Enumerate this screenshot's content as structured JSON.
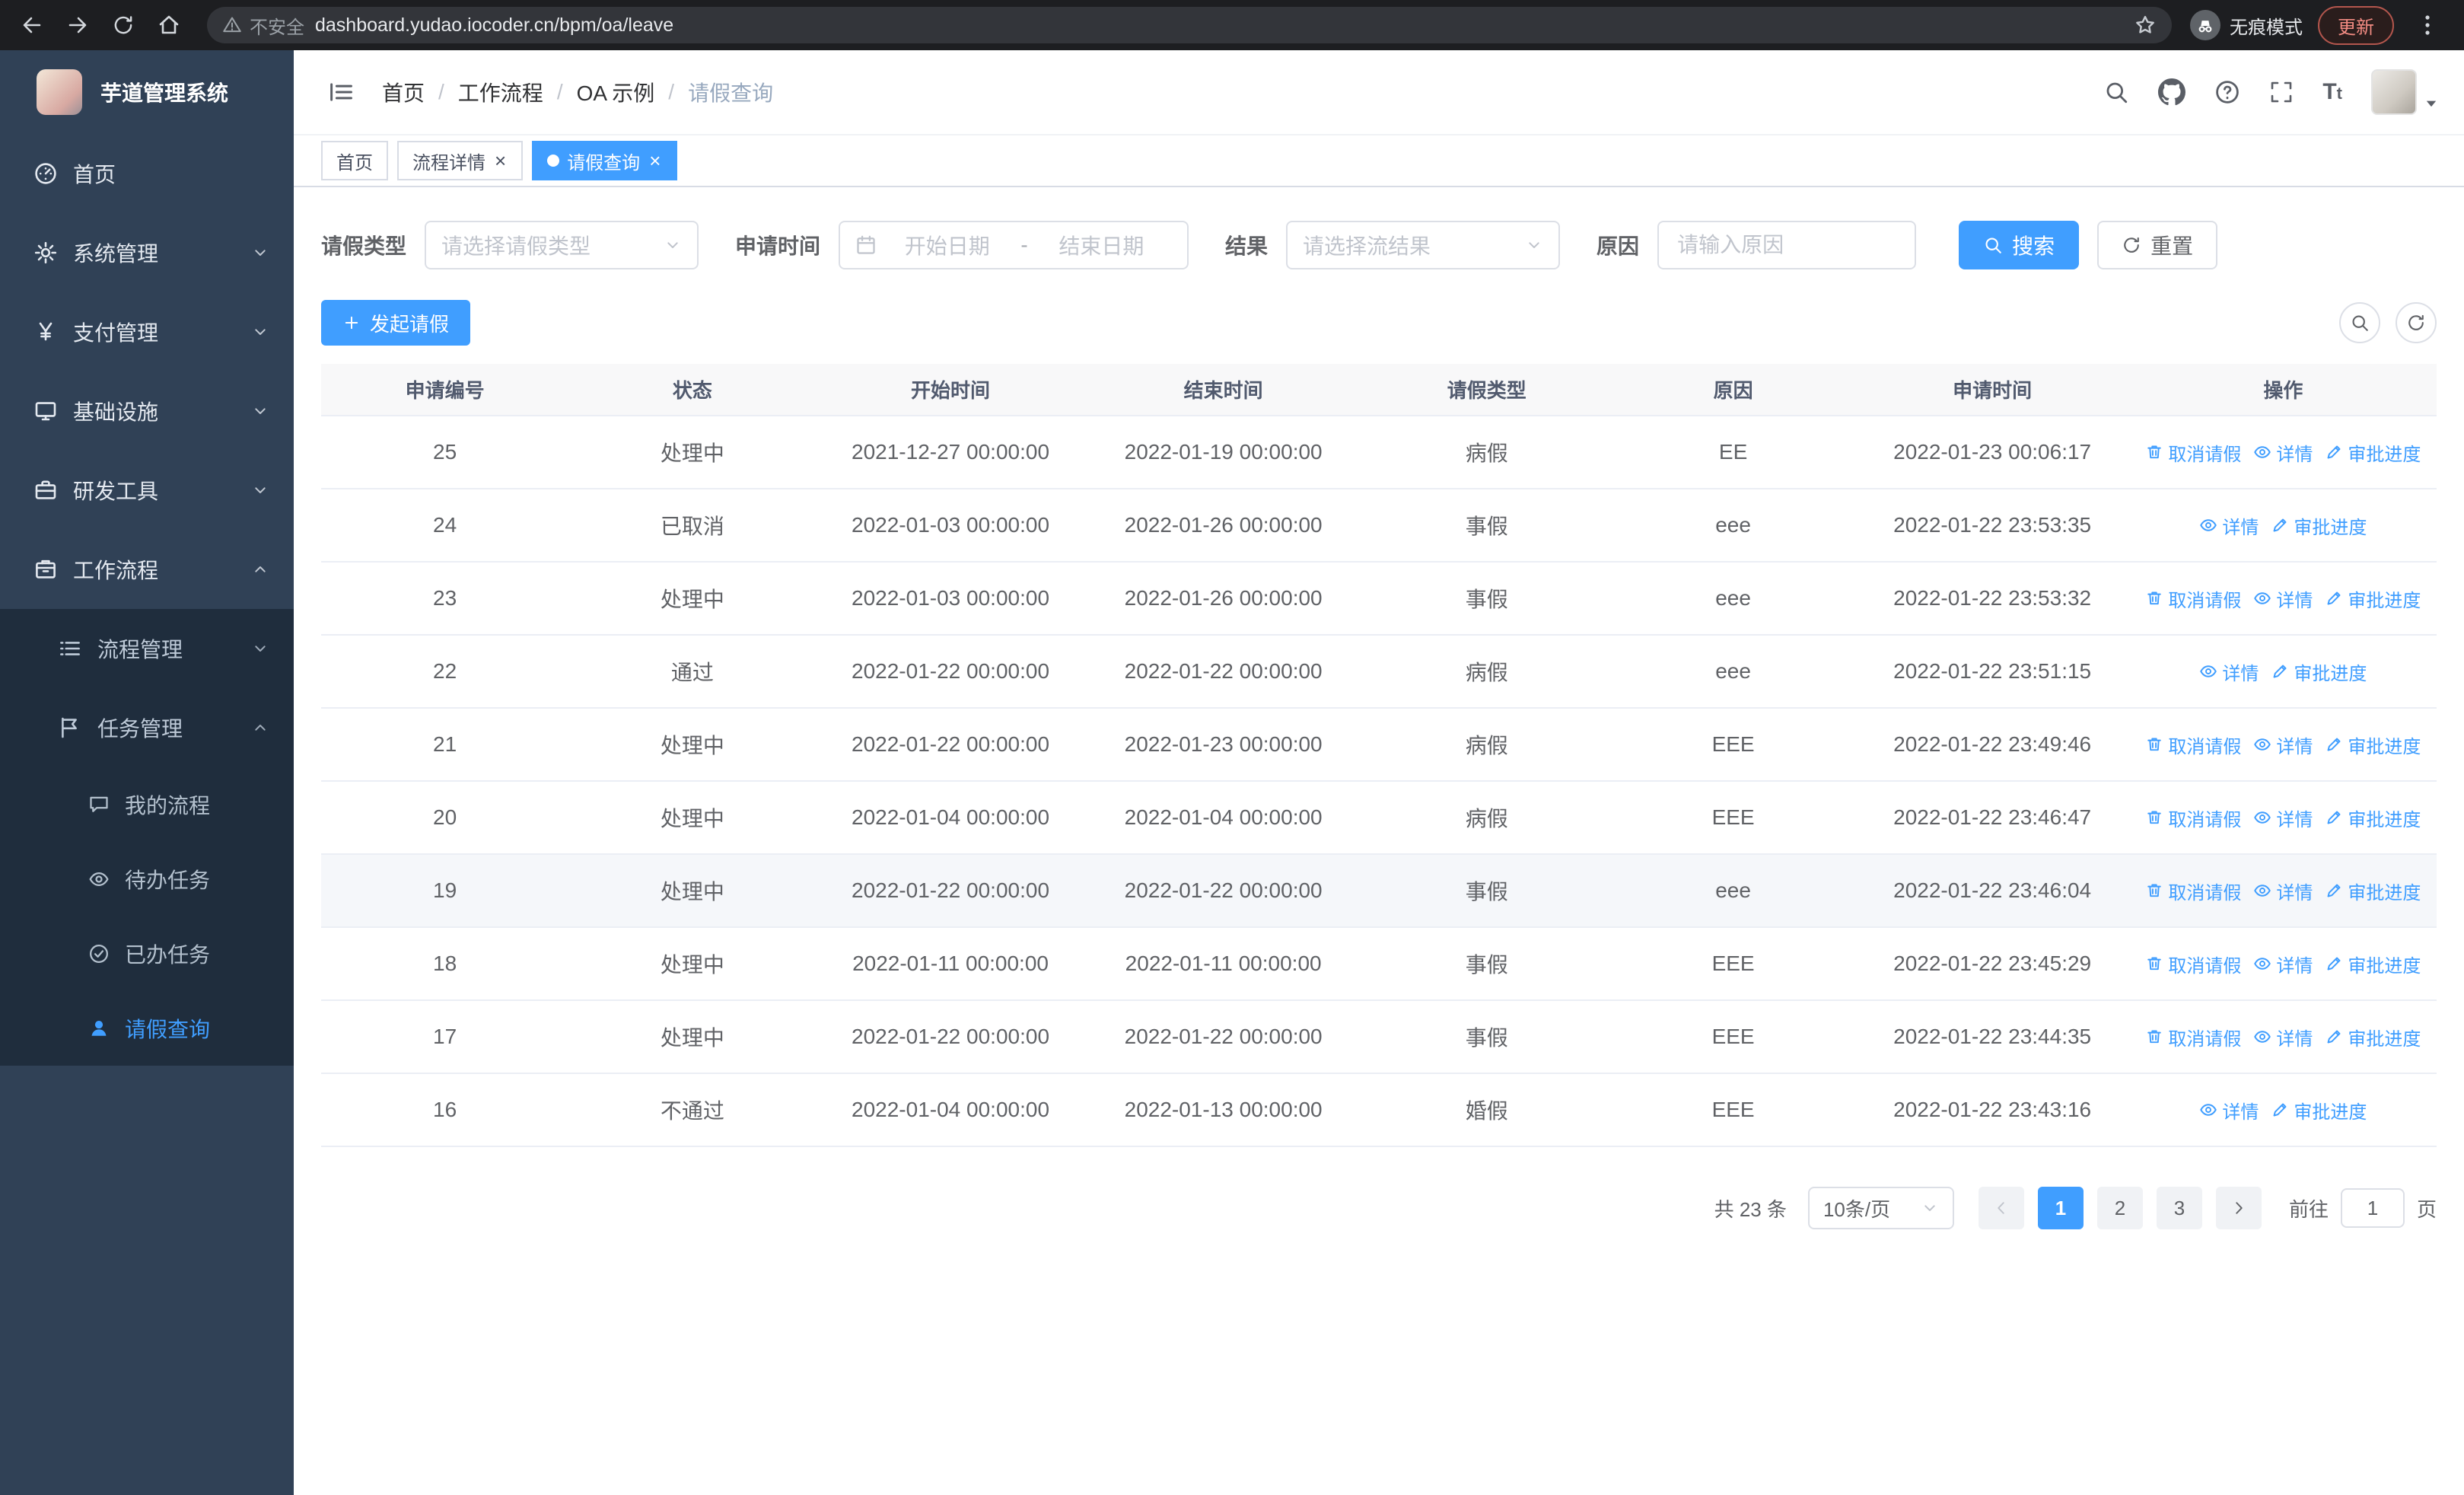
{
  "colors": {
    "accent": "#409eff",
    "sidebar_bg": "#304156",
    "submenu_bg": "#1f2d3d",
    "update_badge": "#f28b82"
  },
  "browser": {
    "security_label": "不安全",
    "url": "dashboard.yudao.iocoder.cn/bpm/oa/leave",
    "incognito_label": "无痕模式",
    "update_label": "更新"
  },
  "sidebar": {
    "app_title": "芋道管理系统",
    "menu": [
      {
        "id": "home",
        "label": "首页",
        "icon": "home",
        "level": 1
      },
      {
        "id": "system",
        "label": "系统管理",
        "icon": "gear",
        "level": 1,
        "arrow": "down"
      },
      {
        "id": "payment",
        "label": "支付管理",
        "icon": "yen",
        "level": 1,
        "arrow": "down"
      },
      {
        "id": "infra",
        "label": "基础设施",
        "icon": "infra",
        "level": 1,
        "arrow": "down"
      },
      {
        "id": "devtools",
        "label": "研发工具",
        "icon": "tools",
        "level": 1,
        "arrow": "down"
      },
      {
        "id": "workflow",
        "label": "工作流程",
        "icon": "workflow",
        "level": 1,
        "arrow": "up"
      },
      {
        "id": "process-mgmt",
        "label": "流程管理",
        "icon": "list-menu",
        "level": 2,
        "arrow": "down"
      },
      {
        "id": "task-mgmt",
        "label": "任务管理",
        "icon": "tasks",
        "level": 2,
        "arrow": "up"
      },
      {
        "id": "my-process",
        "label": "我的流程",
        "icon": "chat",
        "level": 3
      },
      {
        "id": "todo-task",
        "label": "待办任务",
        "icon": "eye",
        "level": 3
      },
      {
        "id": "done-task",
        "label": "已办任务",
        "icon": "done",
        "level": 3
      },
      {
        "id": "leave-query",
        "label": "请假查询",
        "icon": "user",
        "level": 3,
        "active": true
      }
    ]
  },
  "header": {
    "breadcrumb": [
      "首页",
      "工作流程",
      "OA 示例",
      "请假查询"
    ]
  },
  "tabs": [
    {
      "label": "首页",
      "closable": false,
      "active": false
    },
    {
      "label": "流程详情",
      "closable": true,
      "active": false
    },
    {
      "label": "请假查询",
      "closable": true,
      "active": true
    }
  ],
  "filters": {
    "leave_type_label": "请假类型",
    "leave_type_placeholder": "请选择请假类型",
    "apply_time_label": "申请时间",
    "start_date_placeholder": "开始日期",
    "range_separator": "-",
    "end_date_placeholder": "结束日期",
    "result_label": "结果",
    "result_placeholder": "请选择流结果",
    "reason_label": "原因",
    "reason_placeholder": "请输入原因",
    "search_button": "搜索",
    "reset_button": "重置"
  },
  "toolbar": {
    "create_button": "发起请假"
  },
  "table": {
    "columns": [
      "申请编号",
      "状态",
      "开始时间",
      "结束时间",
      "请假类型",
      "原因",
      "申请时间",
      "操作"
    ],
    "actions": {
      "cancel": "取消请假",
      "detail": "详情",
      "progress": "审批进度"
    },
    "rows": [
      {
        "id": "25",
        "status": "处理中",
        "start_time": "2021-12-27 00:00:00",
        "end_time": "2022-01-19 00:00:00",
        "leave_type": "病假",
        "reason": "EE",
        "apply_time": "2022-01-23 00:06:17",
        "can_cancel": true,
        "highlighted": false
      },
      {
        "id": "24",
        "status": "已取消",
        "start_time": "2022-01-03 00:00:00",
        "end_time": "2022-01-26 00:00:00",
        "leave_type": "事假",
        "reason": "eee",
        "apply_time": "2022-01-22 23:53:35",
        "can_cancel": false,
        "highlighted": false
      },
      {
        "id": "23",
        "status": "处理中",
        "start_time": "2022-01-03 00:00:00",
        "end_time": "2022-01-26 00:00:00",
        "leave_type": "事假",
        "reason": "eee",
        "apply_time": "2022-01-22 23:53:32",
        "can_cancel": true,
        "highlighted": false
      },
      {
        "id": "22",
        "status": "通过",
        "start_time": "2022-01-22 00:00:00",
        "end_time": "2022-01-22 00:00:00",
        "leave_type": "病假",
        "reason": "eee",
        "apply_time": "2022-01-22 23:51:15",
        "can_cancel": false,
        "highlighted": false
      },
      {
        "id": "21",
        "status": "处理中",
        "start_time": "2022-01-22 00:00:00",
        "end_time": "2022-01-23 00:00:00",
        "leave_type": "病假",
        "reason": "EEE",
        "apply_time": "2022-01-22 23:49:46",
        "can_cancel": true,
        "highlighted": false
      },
      {
        "id": "20",
        "status": "处理中",
        "start_time": "2022-01-04 00:00:00",
        "end_time": "2022-01-04 00:00:00",
        "leave_type": "病假",
        "reason": "EEE",
        "apply_time": "2022-01-22 23:46:47",
        "can_cancel": true,
        "highlighted": false
      },
      {
        "id": "19",
        "status": "处理中",
        "start_time": "2022-01-22 00:00:00",
        "end_time": "2022-01-22 00:00:00",
        "leave_type": "事假",
        "reason": "eee",
        "apply_time": "2022-01-22 23:46:04",
        "can_cancel": true,
        "highlighted": true
      },
      {
        "id": "18",
        "status": "处理中",
        "start_time": "2022-01-11 00:00:00",
        "end_time": "2022-01-11 00:00:00",
        "leave_type": "事假",
        "reason": "EEE",
        "apply_time": "2022-01-22 23:45:29",
        "can_cancel": true,
        "highlighted": false
      },
      {
        "id": "17",
        "status": "处理中",
        "start_time": "2022-01-22 00:00:00",
        "end_time": "2022-01-22 00:00:00",
        "leave_type": "事假",
        "reason": "EEE",
        "apply_time": "2022-01-22 23:44:35",
        "can_cancel": true,
        "highlighted": false
      },
      {
        "id": "16",
        "status": "不通过",
        "start_time": "2022-01-04 00:00:00",
        "end_time": "2022-01-13 00:00:00",
        "leave_type": "婚假",
        "reason": "EEE",
        "apply_time": "2022-01-22 23:43:16",
        "can_cancel": false,
        "highlighted": false
      }
    ]
  },
  "pagination": {
    "total_label": "共 23 条",
    "page_size": "10条/页",
    "pages": [
      "1",
      "2",
      "3"
    ],
    "active_page": "1",
    "goto_label": "前往",
    "goto_value": "1",
    "unit_label": "页"
  }
}
